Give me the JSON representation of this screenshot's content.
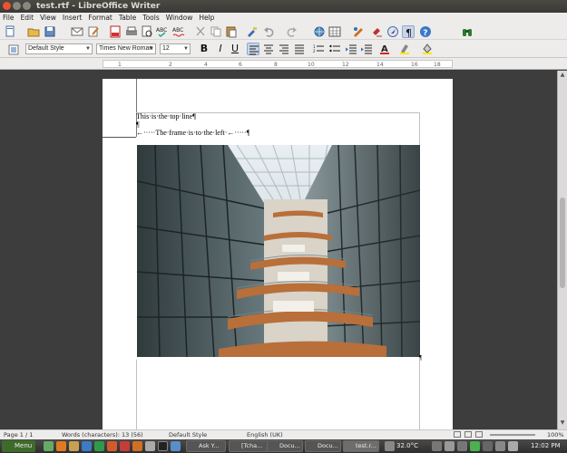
{
  "window": {
    "title": "test.rtf - LibreOffice Writer"
  },
  "menu": [
    "File",
    "Edit",
    "View",
    "Insert",
    "Format",
    "Table",
    "Tools",
    "Window",
    "Help"
  ],
  "formatting": {
    "paragraph_style": "Default Style",
    "font_name": "Times New Roman",
    "font_size": "12",
    "bold_label": "B",
    "italic_label": "I",
    "underline_label": "U"
  },
  "ruler": {
    "numbers": [
      "1",
      "2",
      "4",
      "6",
      "8",
      "10",
      "12",
      "14",
      "16",
      "18"
    ]
  },
  "document": {
    "line1": "This·is·the·top·line¶",
    "line2": "¶",
    "line3": "←·····The·frame·is·to·the·left·←·····¶",
    "para_mark_after_frame": "¶"
  },
  "status": {
    "page": "Page 1 / 1",
    "words": "Words (characters): 13 (56)",
    "style": "Default Style",
    "language": "English (UK)",
    "zoom": "100%"
  },
  "taskbar": {
    "menu_label": "Menu",
    "tasks": [
      "Ask Y...",
      "[Tcha...",
      "Docu...",
      "Docu...",
      "test.r..."
    ],
    "temperature": "32.0°C",
    "clock": "12:02 PM"
  },
  "colors": {
    "title_bg": "#3c3b37",
    "close_button": "#e9542f",
    "toolbar_bg": "#edeceb",
    "workspace_bg": "#3d3d3d",
    "taskbar_bg": "#3a3a3a",
    "menu_button": "#3f6b2a"
  }
}
